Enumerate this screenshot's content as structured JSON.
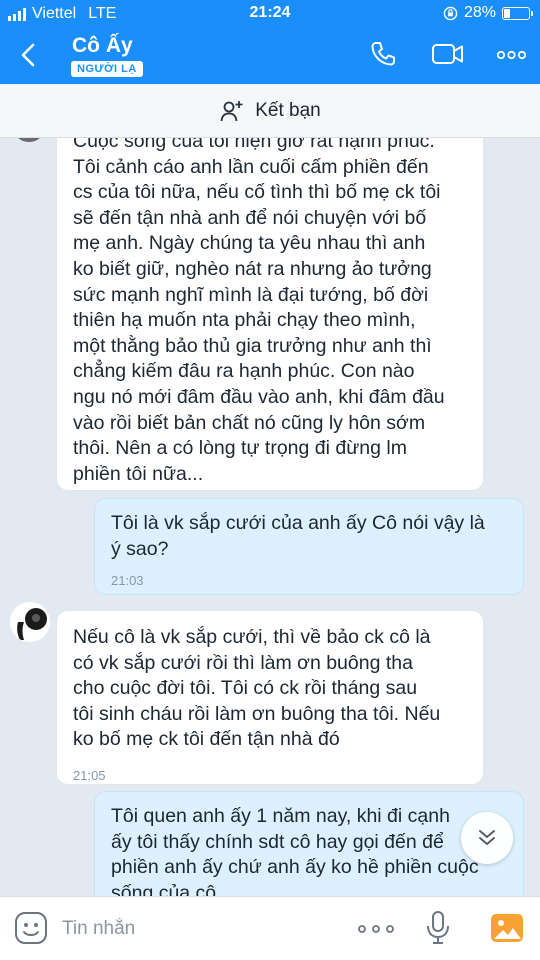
{
  "status_bar": {
    "carrier": "Viettel",
    "network": "LTE",
    "time": "21:24",
    "battery": "28%",
    "battery_level": 0.28
  },
  "header": {
    "contact_name": "Cô Ấy",
    "badge": "NGƯỜI LẠ"
  },
  "friend_bar": {
    "label": "Kết bạn"
  },
  "messages": [
    {
      "direction": "in",
      "lines": [
        "Cuộc sống của tôi hiện giờ rất hạnh phúc.",
        "Tôi cảnh cáo anh lần cuối cấm phiền đến",
        "cs của tôi nữa, nếu cố tình thì bố mẹ ck tôi",
        "sẽ đến tận nhà anh để nói chuyện với bố",
        "mẹ anh. Ngày chúng ta yêu nhau thì anh",
        "ko biết giữ, nghèo nát ra nhưng ảo tưởng",
        "sức mạnh nghĩ mình là đại tướng, bố đời",
        "thiên hạ muốn nta phải chạy theo mình,",
        "một thằng bảo thủ gia trưởng như anh thì",
        "chẳng kiếm đâu ra hạnh phúc. Con nào",
        "ngu nó mới đâm đầu vào anh, khi đâm đầu",
        "vào rồi biết bản chất nó cũng ly hôn sớm",
        "thôi. Nên a có lòng tự trọng đi đừng lm",
        "phiền tôi nữa..."
      ]
    },
    {
      "direction": "out",
      "lines": [
        "Tôi là vk sắp cưới của anh ấy Cô nói vậy là",
        "ý sao?"
      ],
      "time": "21:03"
    },
    {
      "direction": "in",
      "lines": [
        "Nếu cô là vk sắp cưới, thì về bảo ck cô là",
        "có vk sắp cưới rồi thì làm ơn buông tha",
        "cho cuộc đời tôi. Tôi có ck rồi tháng sau",
        "tôi sinh cháu rồi làm ơn buông tha tôi. Nếu",
        "ko bố mẹ ck tôi đến tận nhà đó"
      ],
      "time": "21:05"
    },
    {
      "direction": "out",
      "lines": [
        "Tôi quen anh ấy 1 năm nay, khi đi cạnh",
        "ấy tôi thấy chính sdt cô hay gọi đến để",
        "phiền anh ấy chứ anh ấy ko hề phiền cuộc",
        "sống của cô"
      ]
    }
  ],
  "input_bar": {
    "placeholder": "Tin nhắn"
  },
  "icons": {
    "back": "back-arrow-icon",
    "call": "phone-icon",
    "video": "video-camera-icon",
    "more": "more-dots-icon",
    "add_friend": "add-user-icon",
    "sticker": "emoji-icon",
    "mic": "microphone-icon",
    "image": "image-icon",
    "scroll": "chevron-down-icon"
  },
  "colors": {
    "brand": "#1a8ffb",
    "outgoing_bubble": "#dcf0fd",
    "incoming_bubble": "#ffffff",
    "chat_background": "#e2e9f1",
    "image_icon": "#f7a233"
  }
}
